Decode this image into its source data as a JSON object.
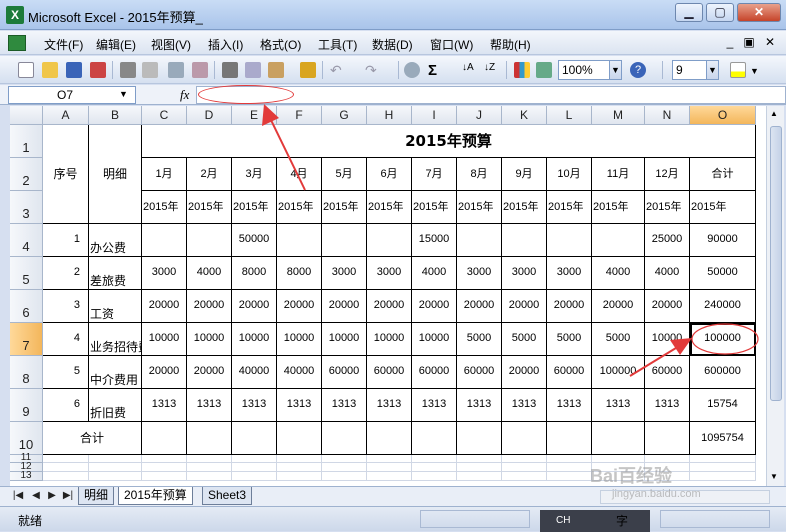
{
  "window": {
    "title": "Microsoft Excel - 2015年预算_",
    "icon": "excel-icon"
  },
  "menu": {
    "items": [
      "文件(F)",
      "编辑(E)",
      "视图(V)",
      "插入(I)",
      "格式(O)",
      "工具(T)",
      "数据(D)",
      "窗口(W)",
      "帮助(H)"
    ]
  },
  "toolbar": {
    "zoom": "100%",
    "font_size": "9",
    "sum_symbol": "Σ"
  },
  "formula_bar": {
    "cell_ref": "O7",
    "fx_label": "fx",
    "formula": ""
  },
  "sheet": {
    "columns": [
      "A",
      "B",
      "C",
      "D",
      "E",
      "F",
      "G",
      "H",
      "I",
      "J",
      "K",
      "L",
      "M",
      "N",
      "O"
    ],
    "selected_column": "O",
    "selected_row": "7",
    "row_numbers": [
      "1",
      "2",
      "3",
      "4",
      "5",
      "6",
      "7",
      "8",
      "9",
      "10",
      "11",
      "12",
      "13"
    ],
    "title": "2015年预算",
    "header_seq": "序号",
    "header_detail": "明细",
    "months": [
      "1月",
      "2月",
      "3月",
      "4月",
      "5月",
      "6月",
      "7月",
      "8月",
      "9月",
      "10月",
      "11月",
      "12月",
      "合计"
    ],
    "year_label": "2015年",
    "rows": [
      {
        "seq": "1",
        "name": "办公费",
        "values": [
          "",
          "",
          "50000",
          "",
          "",
          "",
          "15000",
          "",
          "",
          "",
          "",
          "25000",
          "90000"
        ]
      },
      {
        "seq": "2",
        "name": "差旅费",
        "values": [
          "3000",
          "4000",
          "8000",
          "8000",
          "3000",
          "3000",
          "4000",
          "3000",
          "3000",
          "3000",
          "4000",
          "4000",
          "50000"
        ]
      },
      {
        "seq": "3",
        "name": "工资",
        "values": [
          "20000",
          "20000",
          "20000",
          "20000",
          "20000",
          "20000",
          "20000",
          "20000",
          "20000",
          "20000",
          "20000",
          "20000",
          "240000"
        ]
      },
      {
        "seq": "4",
        "name": "业务招待费",
        "values": [
          "10000",
          "10000",
          "10000",
          "10000",
          "10000",
          "10000",
          "10000",
          "5000",
          "5000",
          "5000",
          "5000",
          "10000",
          "100000"
        ]
      },
      {
        "seq": "5",
        "name": "中介费用",
        "values": [
          "20000",
          "20000",
          "40000",
          "40000",
          "60000",
          "60000",
          "60000",
          "60000",
          "20000",
          "60000",
          "100000",
          "60000",
          "600000"
        ]
      },
      {
        "seq": "6",
        "name": "折旧费",
        "values": [
          "1313",
          "1313",
          "1313",
          "1313",
          "1313",
          "1313",
          "1313",
          "1313",
          "1313",
          "1313",
          "1313",
          "1313",
          "15754"
        ]
      }
    ],
    "total_label": "合计",
    "grand_total": "1095754"
  },
  "tabs": {
    "items": [
      "明细",
      "2015年预算",
      "Sheet3"
    ],
    "active": "2015年预算"
  },
  "status": {
    "text": "就绪",
    "ime_text": "CH",
    "ime_char": "字"
  },
  "watermark": {
    "text": "Bai百经验",
    "sub": "jingyan.baidu.com"
  },
  "colors": {
    "annotation": "#e23a3a",
    "selection": "#f3b65b",
    "title_bar": "#a9c4ea"
  }
}
